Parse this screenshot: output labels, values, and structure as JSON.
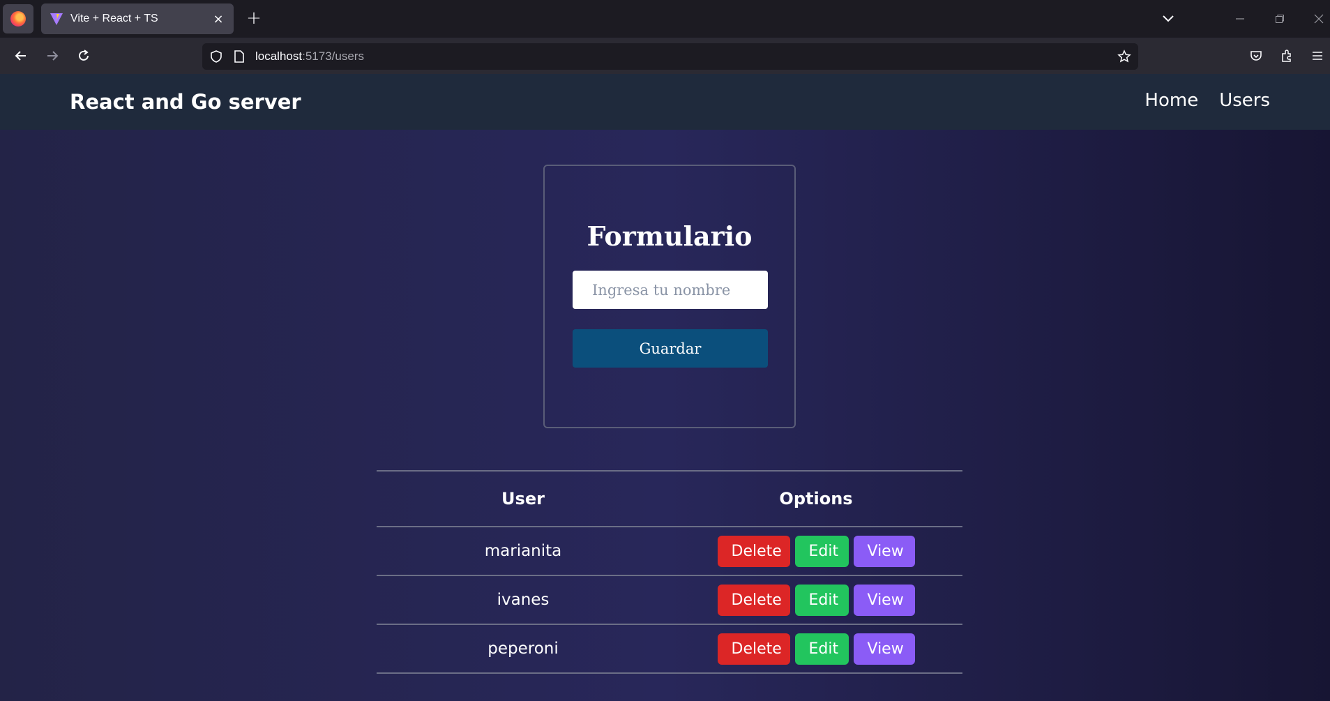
{
  "browser": {
    "tab_title": "Vite + React + TS",
    "tab_close": "×",
    "new_tab": "+",
    "url_host": "localhost",
    "url_path": ":5173/users"
  },
  "site": {
    "title": "React and Go server",
    "nav": [
      "Home",
      "Users"
    ]
  },
  "form": {
    "title": "Formulario",
    "placeholder": "Ingresa tu nombre",
    "save_label": "Guardar"
  },
  "table": {
    "headers": [
      "User",
      "Options"
    ],
    "rows": [
      {
        "user": "marianita"
      },
      {
        "user": "ivanes"
      },
      {
        "user": "peperoni"
      }
    ],
    "actions": {
      "delete": "Delete",
      "edit": "Edit",
      "view": "View"
    }
  },
  "colors": {
    "delete": "#dc2626",
    "edit": "#22c55e",
    "view": "#8b5cf6",
    "save": "#0b4f7c",
    "header_bg": "#1f2a3c"
  }
}
